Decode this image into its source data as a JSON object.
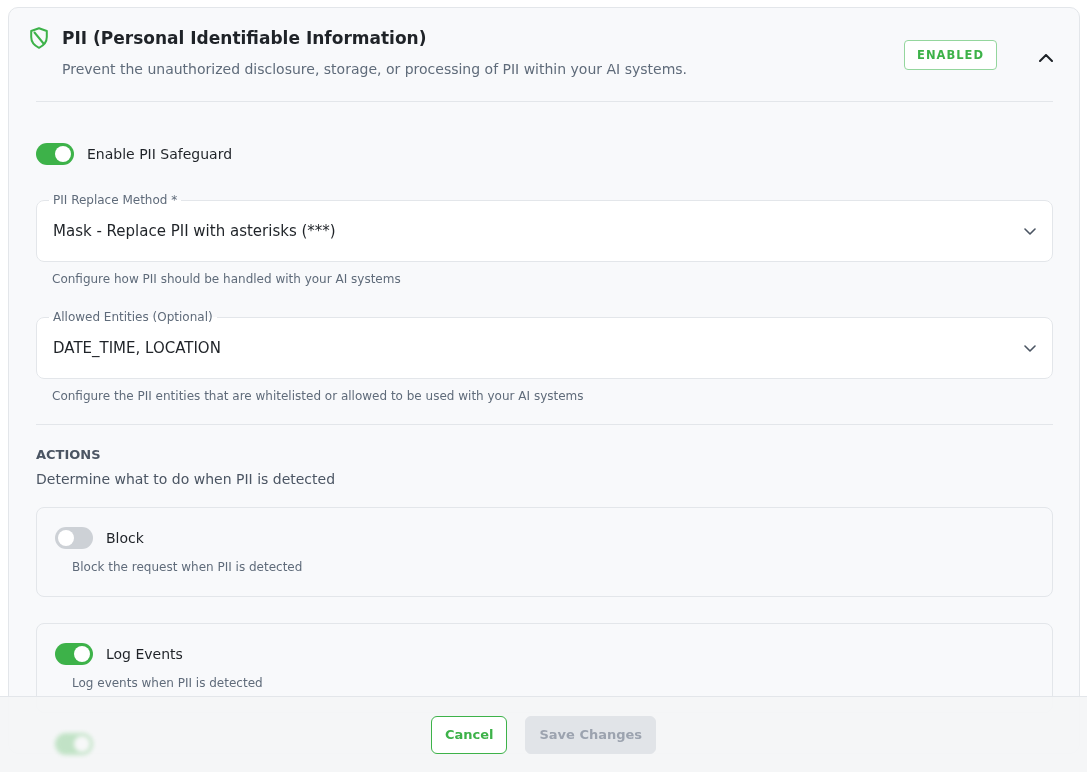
{
  "panel": {
    "title": "PII (Personal Identifiable Information)",
    "description": "Prevent the unauthorized disclosure, storage, or processing of PII within your AI systems.",
    "status_badge": "ENABLED",
    "expanded": true
  },
  "enable_toggle": {
    "label": "Enable PII Safeguard",
    "on": true
  },
  "fields": [
    {
      "label": "PII Replace Method *",
      "value": "Mask - Replace PII with asterisks (***)",
      "helper": "Configure how PII should be handled with your AI systems"
    },
    {
      "label": "Allowed Entities (Optional)",
      "value": "DATE_TIME, LOCATION",
      "helper": "Configure the PII entities that are whitelisted or allowed to be used with your AI systems"
    }
  ],
  "actions": {
    "heading": "ACTIONS",
    "subheading": "Determine what to do when PII is detected",
    "items": [
      {
        "kind": "card",
        "label": "Block",
        "description": "Block the request when PII is detected",
        "on": false
      },
      {
        "kind": "card",
        "label": "Log Events",
        "description": "Log events when PII is detected",
        "on": true
      },
      {
        "kind": "obscured",
        "on": true
      }
    ]
  },
  "footer": {
    "buttons": [
      {
        "label": "Cancel",
        "kind": "cancel",
        "disabled": false
      },
      {
        "label": "Save Changes",
        "kind": "save",
        "disabled": true
      }
    ]
  }
}
